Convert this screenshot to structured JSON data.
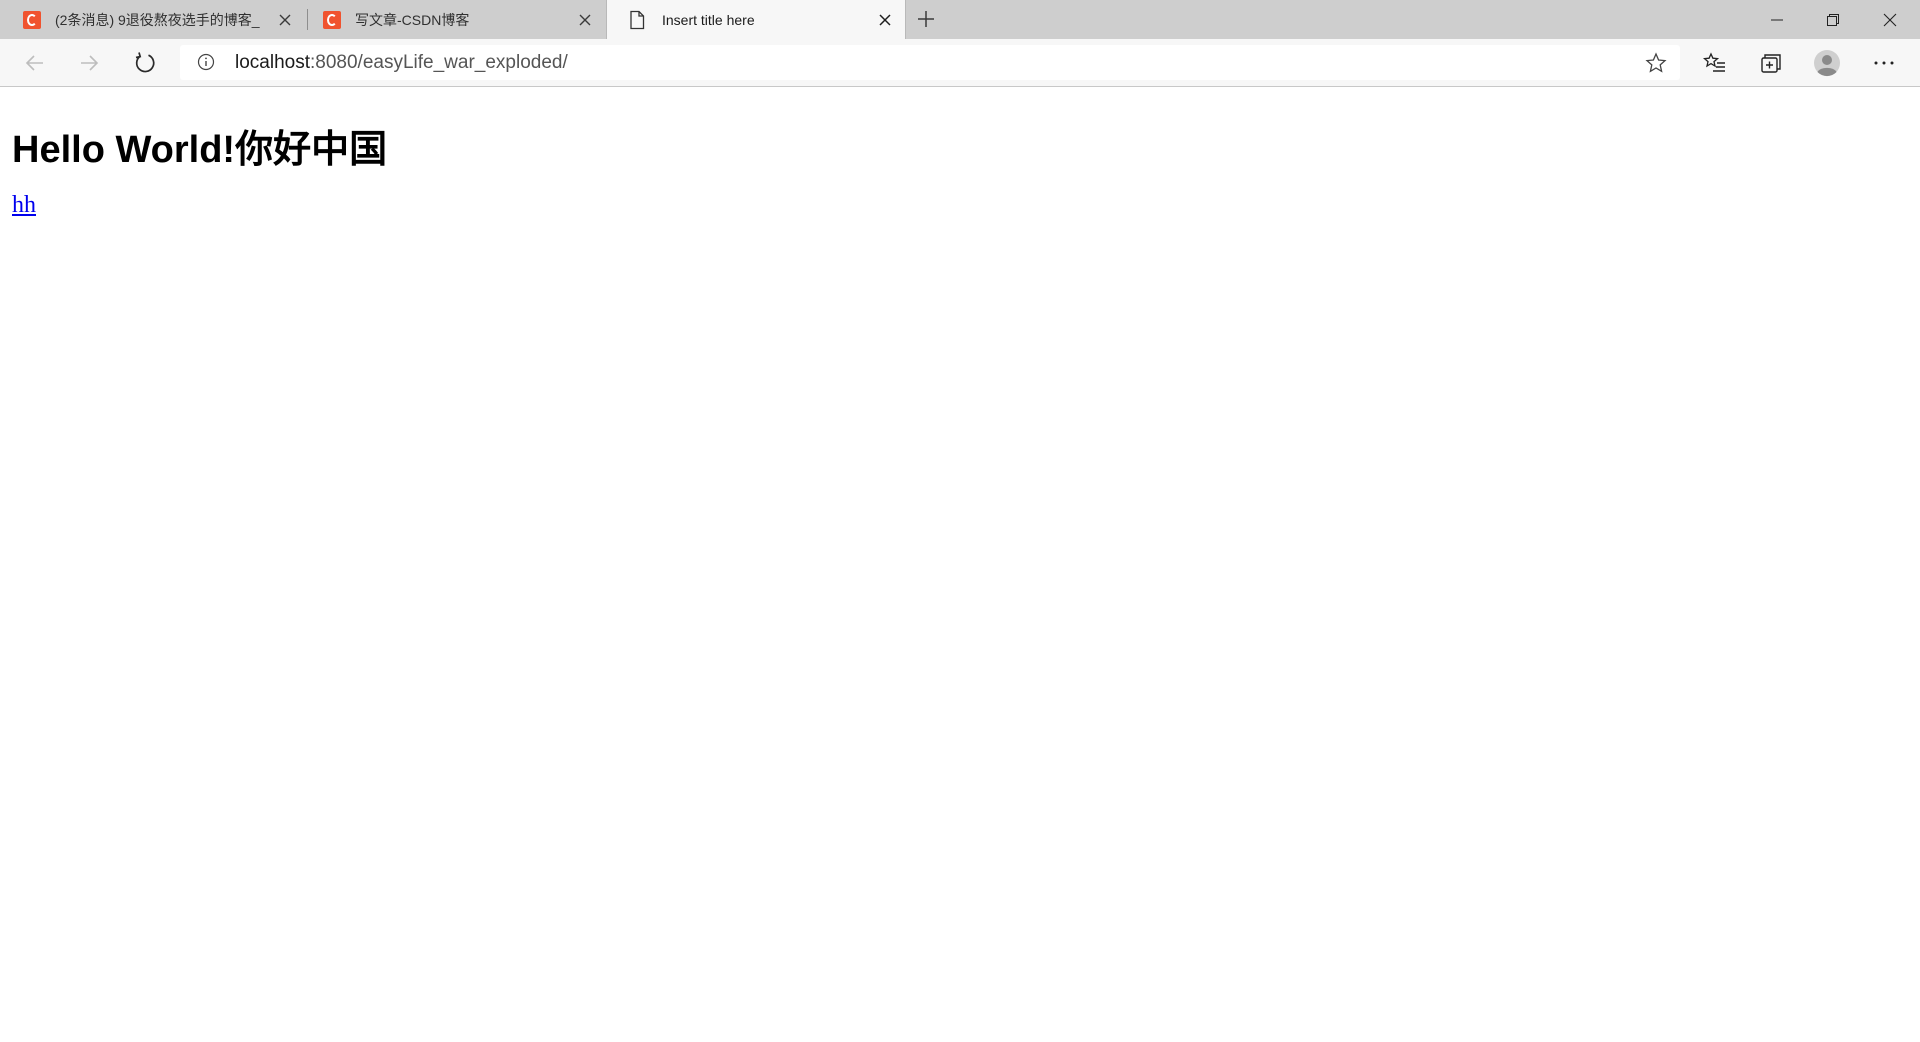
{
  "browser": {
    "tabs": [
      {
        "title": "(2条消息) 9退役熬夜选手的博客_",
        "favicon": "csdn-icon",
        "active": false
      },
      {
        "title": "写文章-CSDN博客",
        "favicon": "csdn-icon",
        "active": false
      },
      {
        "title": "Insert title here",
        "favicon": "document-icon",
        "active": true
      }
    ],
    "address": {
      "host": "localhost",
      "rest": ":8080/easyLife_war_exploded/"
    },
    "colors": {
      "tabstrip": "#cecece",
      "toolbar": "#f7f7f7",
      "csdn_brand": "#f0532f"
    }
  },
  "page": {
    "heading": "Hello World!你好中国",
    "link_text": "hh",
    "link_color": "#0000ee"
  }
}
